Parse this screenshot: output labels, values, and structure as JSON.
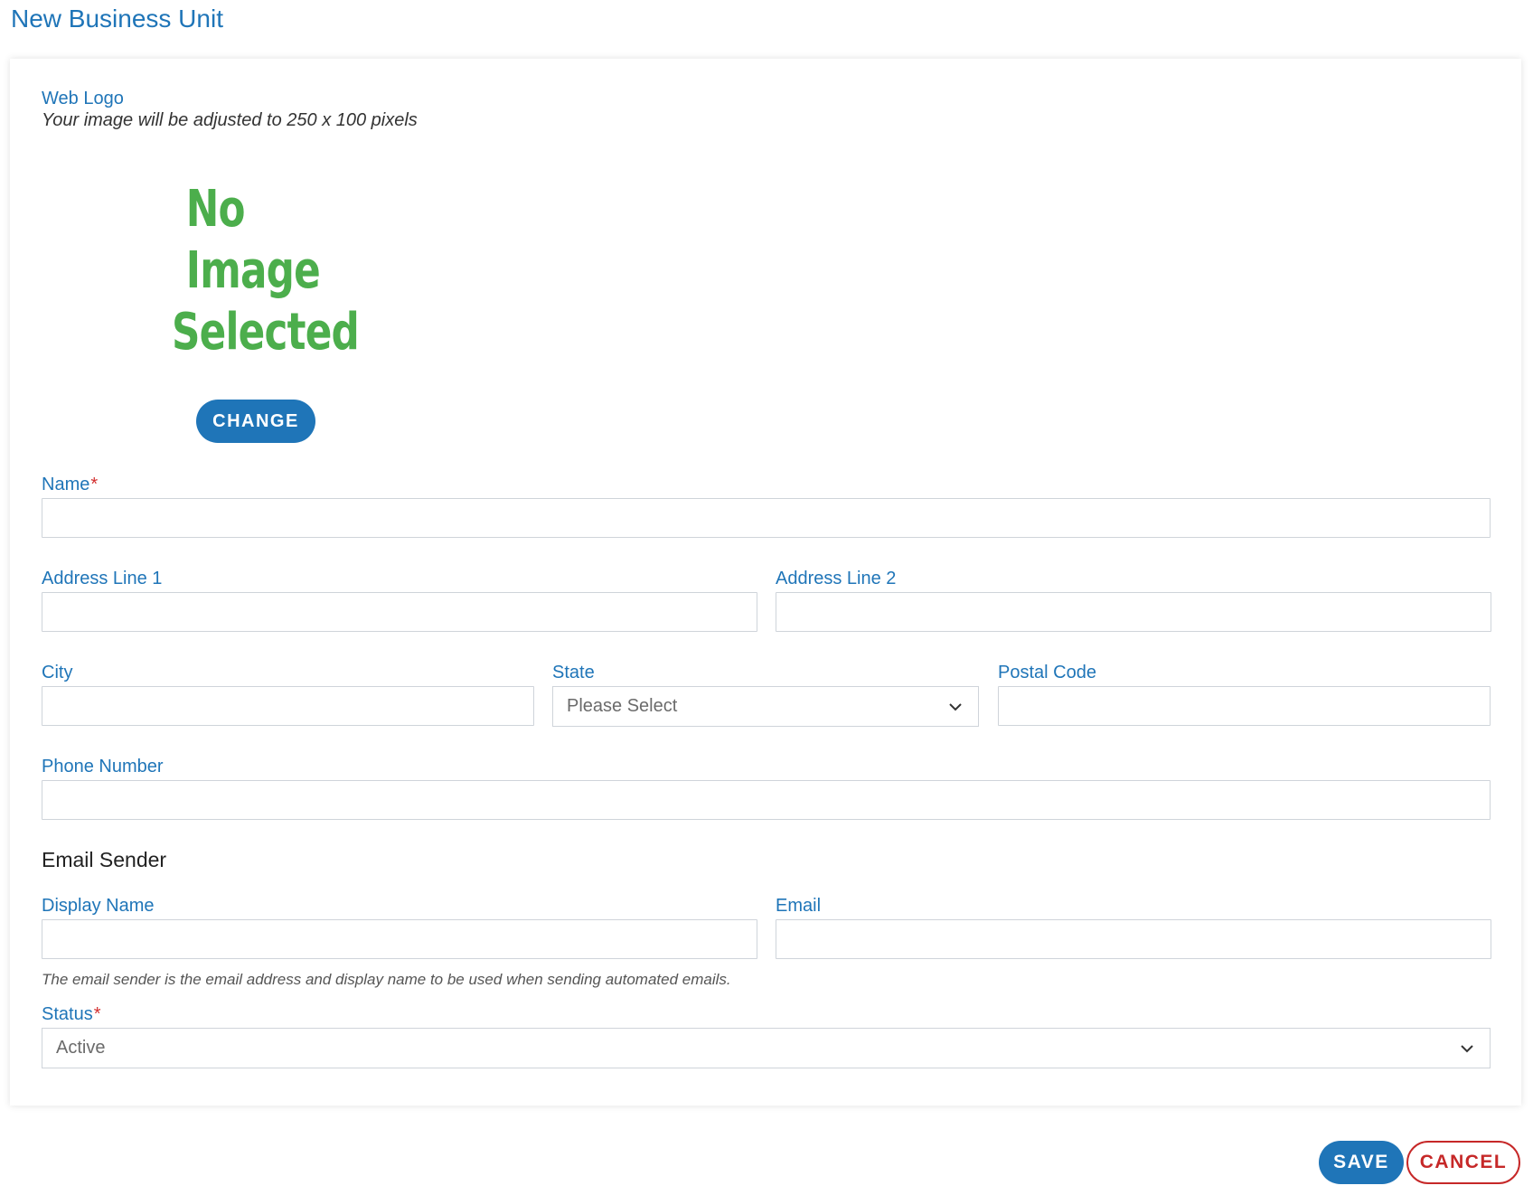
{
  "page": {
    "title": "New Business Unit"
  },
  "web_logo": {
    "label": "Web Logo",
    "hint": "Your image will be adjusted to 250 x 100 pixels",
    "placeholder_line1": "No Image",
    "placeholder_line2": "Selected",
    "change_label": "CHANGE"
  },
  "fields": {
    "name": {
      "label": "Name",
      "required_mark": "*",
      "value": ""
    },
    "address_line_1": {
      "label": "Address Line 1",
      "value": ""
    },
    "address_line_2": {
      "label": "Address Line 2",
      "value": ""
    },
    "city": {
      "label": "City",
      "value": ""
    },
    "state": {
      "label": "State",
      "selected": "Please Select"
    },
    "postal_code": {
      "label": "Postal Code",
      "value": ""
    },
    "phone_number": {
      "label": "Phone Number",
      "value": ""
    }
  },
  "email_sender": {
    "section_title": "Email Sender",
    "display_name": {
      "label": "Display Name",
      "value": ""
    },
    "email": {
      "label": "Email",
      "value": ""
    },
    "hint": "The email sender is the email address and display name to be used when sending automated emails."
  },
  "status": {
    "label": "Status",
    "required_mark": "*",
    "selected": "Active"
  },
  "actions": {
    "save_label": "SAVE",
    "cancel_label": "CANCEL"
  },
  "colors": {
    "primary": "#1f75b8",
    "danger": "#c62828",
    "placeholder_image_text": "#4cae4c"
  },
  "icons": {
    "select_chevron": "chevron-down-icon"
  }
}
